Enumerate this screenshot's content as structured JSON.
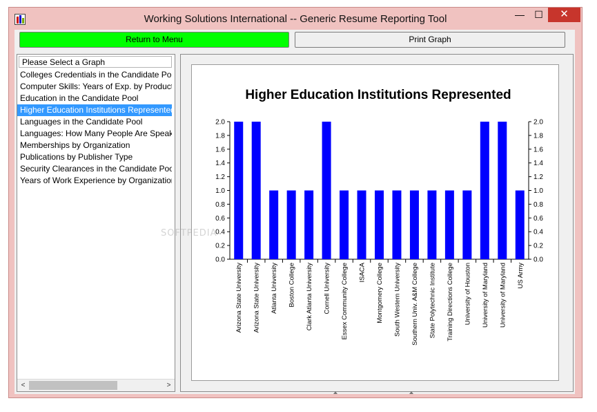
{
  "window": {
    "title": "Working Solutions International  --  Generic Resume Reporting Tool",
    "minimize_glyph": "—",
    "maximize_glyph": "☐",
    "close_glyph": "✕"
  },
  "toolbar": {
    "return_label": "Return to Menu",
    "print_label": "Print Graph"
  },
  "graph_list": {
    "header": "Please Select a Graph",
    "items": [
      "Colleges Credentials in the Candidate Pool",
      "Computer Skills: Years of Exp. by Product",
      "Education in the Candidate Pool",
      "Higher Education Institutions Represented",
      "Languages in the Candidate Pool",
      "Languages: How Many People Are Speaking",
      "Memberships by Organization",
      "Publications by Publisher Type",
      "Security Clearances in the Candidate Pool",
      "Years of Work Experience by Organization"
    ],
    "selected_index": 3
  },
  "scrollbar": {
    "left_glyph": "<",
    "right_glyph": ">"
  },
  "watermark": "SOFTPEDIA",
  "colors": {
    "bar": "#0000ff",
    "return_button": "#00ff00",
    "selection": "#3399ff"
  },
  "chart_data": {
    "type": "bar",
    "title": "Higher Education Institutions Represented",
    "xlabel": "",
    "ylabel": "",
    "ylim": [
      0,
      2.0
    ],
    "yticks": [
      "0.0",
      "0.2",
      "0.4",
      "0.6",
      "0.8",
      "1.0",
      "1.2",
      "1.4",
      "1.6",
      "1.8",
      "2.0"
    ],
    "grid": false,
    "categories": [
      "Arizona State University",
      "Arizona State University",
      "Atlanta University",
      "Boston College",
      "Clark Atlanta University",
      "Cornell University",
      "Essex Community College",
      "ISACA",
      "Montgomery College",
      "South Western University",
      "Southern Univ. A&M College",
      "State Polytechnic Institute",
      "Training Directions College",
      "University of Houston",
      "University of Maryland",
      "University of Maryland",
      "US Army"
    ],
    "values": [
      2,
      2,
      1,
      1,
      1,
      2,
      1,
      1,
      1,
      1,
      1,
      1,
      1,
      1,
      2,
      2,
      1
    ]
  }
}
